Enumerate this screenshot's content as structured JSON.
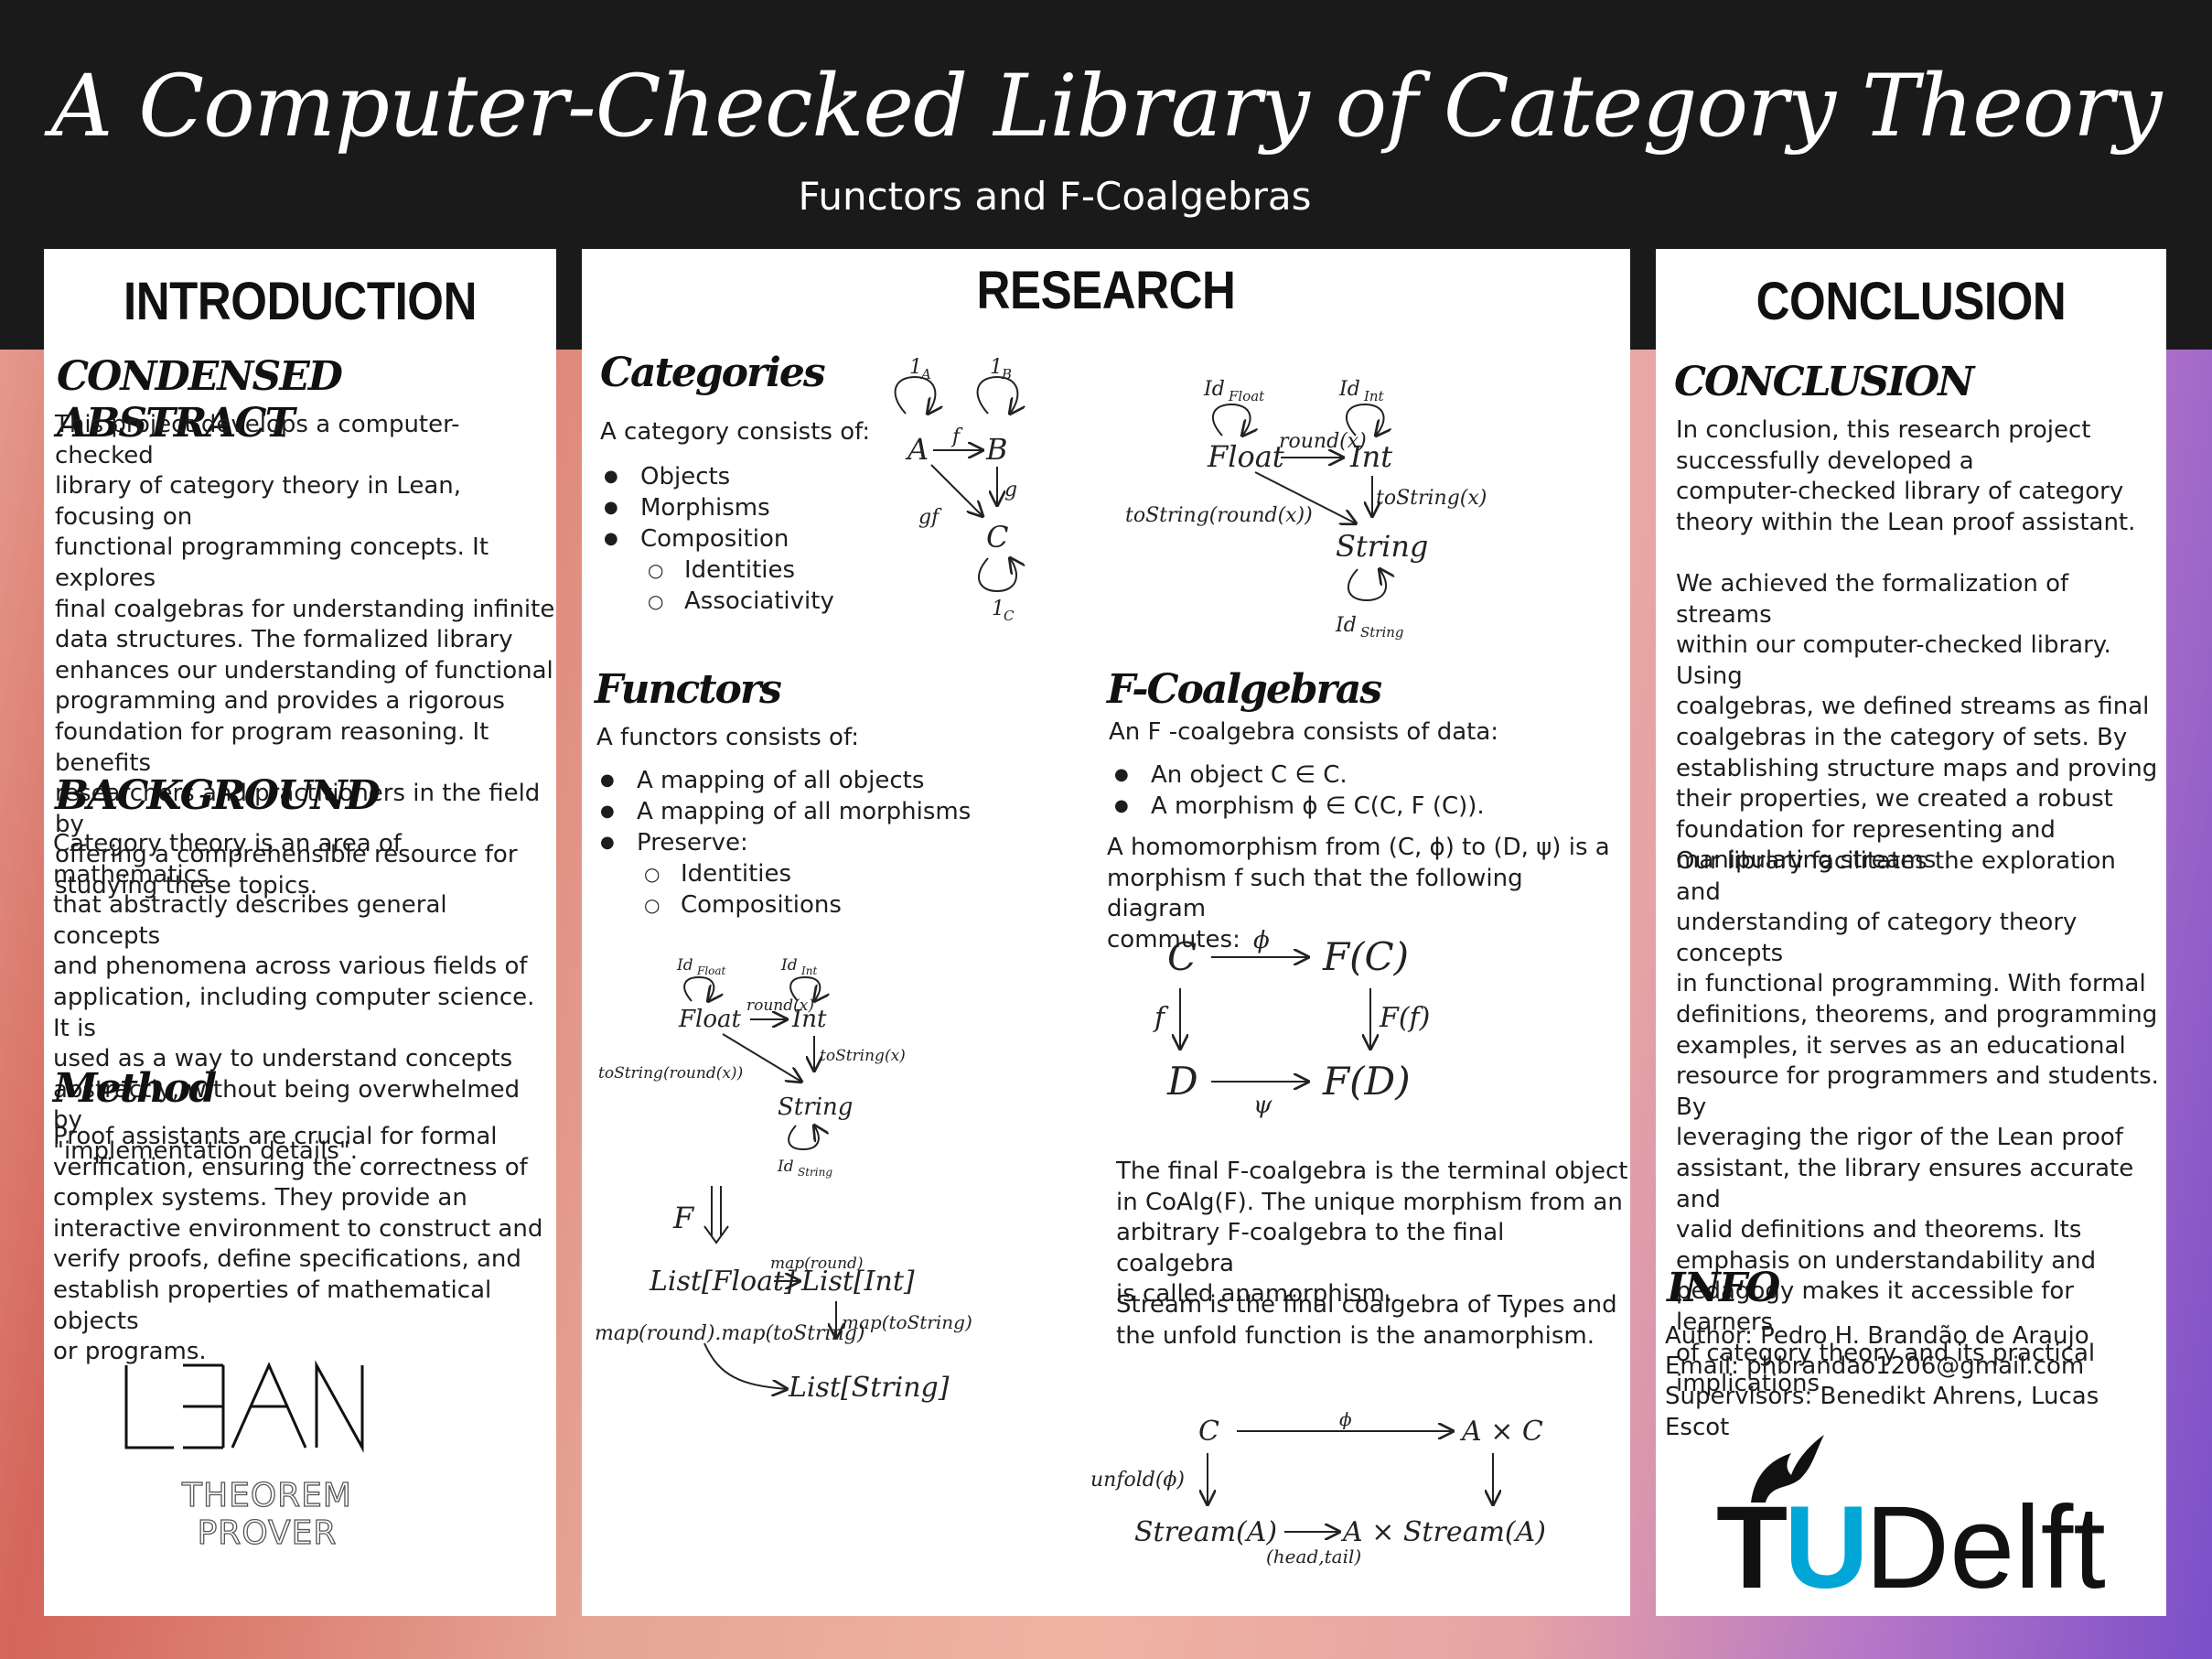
{
  "header": {
    "title": "A Computer-Checked Library of Category Theory",
    "subtitle": "Functors and  F-Coalgebras"
  },
  "introduction": {
    "heading": "INTRODUCTION",
    "abstract_heading": "CONDENSED ABSTRACT",
    "abstract_text": "This project develops a computer-checked\nlibrary of category theory in  Lean, focusing on\nfunctional programming concepts.  It explores\nfinal coalgebras for understanding infinite\ndata structures. The formalized library\nenhances our understanding of functional\nprogramming and provides a rigorous\nfoundation for program reasoning.  It benefits\nresearchers and practitioners in the field by\noffering a comprehensible resource for\nstudying these topics.",
    "background_heading": "BACKGROUND",
    "background_text": "Category theory is an area of mathematics\nthat abstractly describes general concepts\nand phenomena across various fields of\napplication, including computer science.  It is\nused as a way to understand concepts\nabstractly, without being overwhelmed by\n\"implementation details\".",
    "method_heading": "Method",
    "method_text": "Proof assistants are crucial for formal\nverification, ensuring the correctness of\ncomplex systems. They provide an\ninteractive environment to construct and\nverify proofs, define specifications, and\nestablish properties of mathematical objects\nor programs.",
    "logo_tagline": "THEOREM PROVER"
  },
  "research": {
    "heading": "RESEARCH",
    "categories": {
      "heading": "Categories",
      "intro": "A category consists of:",
      "items": [
        "Objects",
        "Morphisms",
        "Composition"
      ],
      "subitems": [
        "Identities",
        "Associativity"
      ]
    },
    "functors": {
      "heading": "Functors",
      "intro": "A functors consists of:",
      "items": [
        "A mapping of all objects",
        "A mapping of all morphisms",
        "Preserve:"
      ],
      "subitems": [
        "Identities",
        "Compositions"
      ]
    },
    "coalgebras": {
      "heading": "F-Coalgebras",
      "intro": "An  F -coalgebra consists of data:",
      "items": [
        "An object C ∈ C.",
        "A morphism ϕ ∈ C(C,  F (C))."
      ],
      "homomorphism": "A homomorphism from (C, ϕ) to (D, ψ) is a\nmorphism f such that the following diagram\ncommutes:",
      "final_text": "The final  F-coalgebra is the terminal object\nin CoAlg(F). The unique morphism from an\narbitrary  F-coalgebra to the final coalgebra\nis called anamorphism.",
      "stream_text": "Stream is the final coalgebra of Types and\nthe unfold function is the anamorphism."
    }
  },
  "conclusion": {
    "heading": "CONCLUSION",
    "sub_heading": "CONCLUSION",
    "p1": "In conclusion, this research project\nsuccessfully developed a\ncomputer-checked library of category\ntheory within the  Lean proof assistant.",
    "p2": "We achieved the formalization of streams\nwithin our computer-checked library. Using\ncoalgebras, we defined streams as final\ncoalgebras in the category of sets.  By\nestablishing structure maps and proving\ntheir properties, we created a robust\nfoundation for representing and\nmanipulating streams .",
    "p3": "Our library facilitates the exploration and\nunderstanding of category theory concepts\nin functional programming. With formal\ndefinitions, theorems, and programming\nexamples, it serves as an educational\nresource for programmers and students.  By\nleveraging the rigor of the  Lean proof\nassistant, the library ensures accurate and\nvalid definitions and theorems.  Its\nemphasis on understandability and\npedagogy makes it accessible for learners\nof category theory and its practical\nimplications.",
    "info_heading": "INFO",
    "author": "Author:  Pedro  H.  Brandão de Araujo",
    "email": "Email: phbrandao1206@gmail.com",
    "supervisors": "Supervisors:  Benedikt Ahrens,  Lucas  Escot",
    "logo_tu": "TU",
    "logo_delft": "Delft"
  },
  "diagrams": {
    "cat": {
      "A": "A",
      "B": "B",
      "C": "C",
      "f": "f",
      "g": "g",
      "gf": "gf",
      "idA": "1",
      "subA": "A",
      "idB": "1",
      "subB": "B",
      "idC": "1",
      "subC": "C"
    },
    "types": {
      "float": "Float",
      "int": "Int",
      "string": "String",
      "round": "round(x)",
      "tostr": "toString(x)",
      "comp": "toString(round(x))",
      "id": "Id",
      "subF": "Float",
      "subI": "Int",
      "subS": "String"
    },
    "lists": {
      "F": "F",
      "lf": "List[Float]",
      "li": "List[Int]",
      "ls": "List[String]",
      "mr": "map(round)",
      "mt": "map(toString)",
      "mc": "map(round).map(toString)"
    },
    "hom": {
      "C": "C",
      "FC": "F(C)",
      "D": "D",
      "FD": "F(D)",
      "phi": "ϕ",
      "psi": "ψ",
      "f": "f",
      "Ff": "F(f)"
    },
    "stream": {
      "C": "C",
      "AC": "A × C",
      "SA": "Stream(A)",
      "ASA": "A × Stream(A)",
      "phi": "ϕ",
      "unfold": "unfold(ϕ)",
      "ht": "(head,tail)"
    }
  }
}
